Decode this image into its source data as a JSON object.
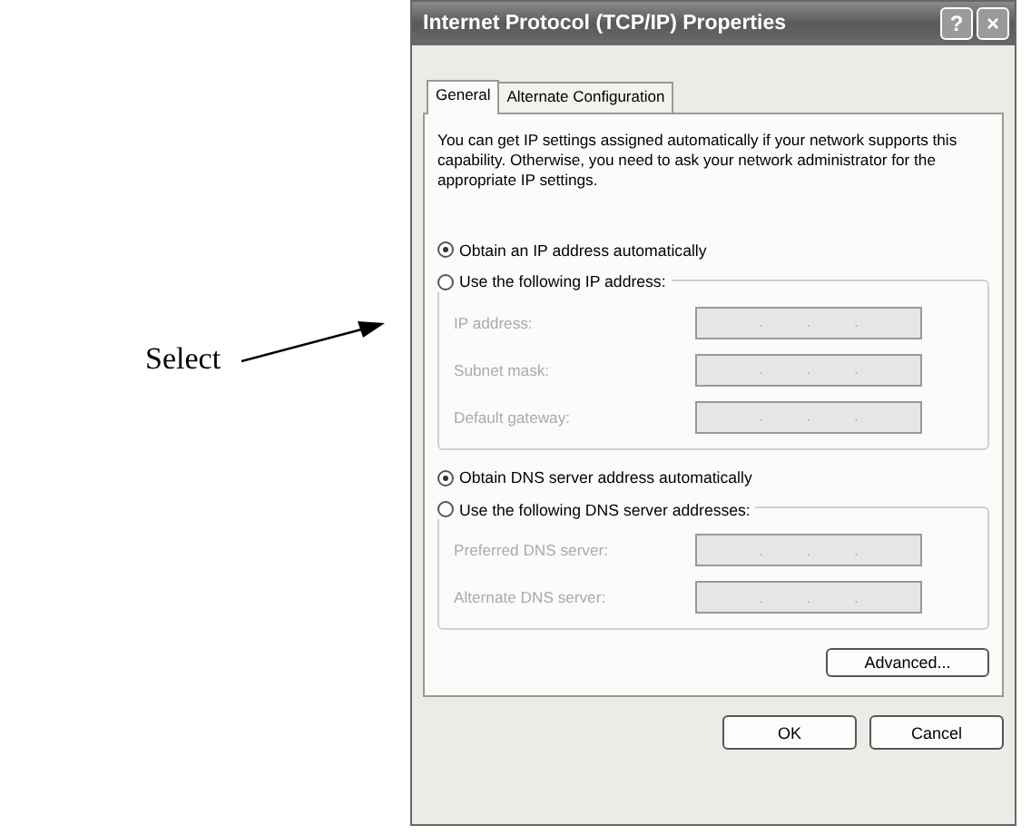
{
  "annotation": {
    "label": "Select"
  },
  "window": {
    "title": "Internet Protocol (TCP/IP) Properties",
    "help_button": "?",
    "close_button": "×"
  },
  "tabs": [
    {
      "label": "General",
      "selected": true
    },
    {
      "label": "Alternate Configuration",
      "selected": false
    }
  ],
  "description": "You can get IP settings assigned automatically if your network supports this capability. Otherwise, you need to ask your network administrator for the appropriate IP settings.",
  "ip_options": [
    {
      "label": "Obtain an IP address automatically",
      "selected": true
    },
    {
      "label": "Use the following IP address:",
      "selected": false
    }
  ],
  "ip_fields": [
    {
      "label": "IP address:",
      "separators": [
        ".",
        ".",
        "."
      ],
      "disabled": true
    },
    {
      "label": "Subnet mask:",
      "separators": [
        ".",
        ".",
        "."
      ],
      "disabled": true
    },
    {
      "label": "Default gateway:",
      "separators": [
        ".",
        ".",
        "."
      ],
      "disabled": true
    }
  ],
  "dns_options": [
    {
      "label": "Obtain DNS server address automatically",
      "selected": true
    },
    {
      "label": "Use the following DNS server addresses:",
      "selected": false
    }
  ],
  "dns_fields": [
    {
      "label": "Preferred DNS server:",
      "separators": [
        ".",
        ".",
        "."
      ],
      "disabled": true
    },
    {
      "label": "Alternate DNS server:",
      "separators": [
        ".",
        ".",
        "."
      ],
      "disabled": true
    }
  ],
  "advanced_button": "Advanced...",
  "buttons": [
    "OK",
    "Cancel"
  ]
}
